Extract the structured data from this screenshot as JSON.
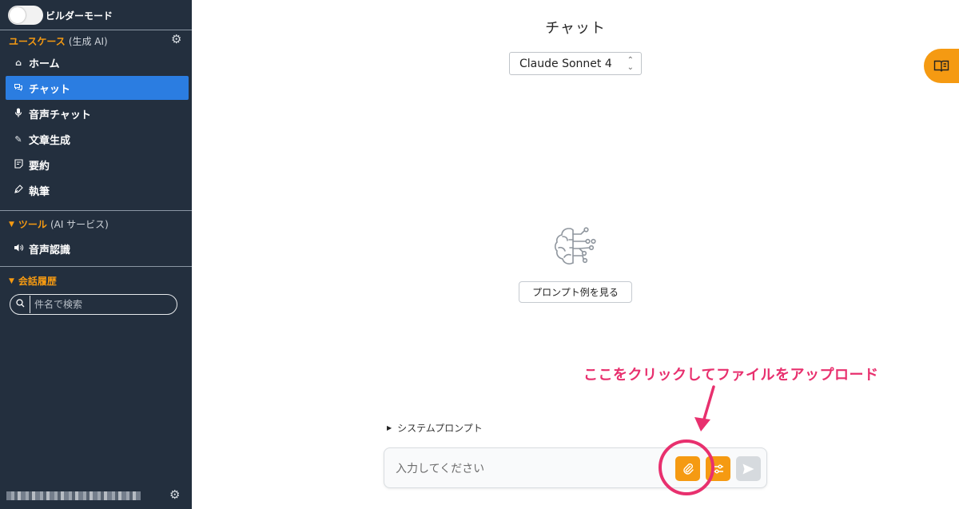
{
  "sidebar": {
    "builder_mode_label": "ビルダーモード",
    "usecase_section": {
      "title": "ユースケース",
      "subtitle": "(生成 AI)"
    },
    "items": [
      {
        "label": "ホーム",
        "icon": "home-icon"
      },
      {
        "label": "チャット",
        "icon": "chat-icon"
      },
      {
        "label": "音声チャット",
        "icon": "mic-icon"
      },
      {
        "label": "文章生成",
        "icon": "pencil-icon"
      },
      {
        "label": "要約",
        "icon": "summary-icon"
      },
      {
        "label": "執筆",
        "icon": "pen-icon"
      }
    ],
    "tools_section": {
      "title": "ツール",
      "subtitle": "(AI サービス)"
    },
    "tool_items": [
      {
        "label": "音声認識",
        "icon": "speaker-icon"
      }
    ],
    "history_section": {
      "title": "会話履歴"
    },
    "search": {
      "placeholder": "件名で検索"
    }
  },
  "main": {
    "title": "チャット",
    "model_select": {
      "value": "Claude Sonnet 4"
    },
    "prompt_examples_button": "プロンプト例を見る",
    "system_prompt_label": "システムプロンプト",
    "input": {
      "placeholder": "入力してください",
      "value": ""
    }
  },
  "annotation": {
    "text": "ここをクリックしてファイルをアップロード"
  },
  "colors": {
    "sidebar_bg": "#232f3e",
    "accent": "#f59a12",
    "active_nav": "#2b7de1",
    "annotation": "#e8306e"
  }
}
